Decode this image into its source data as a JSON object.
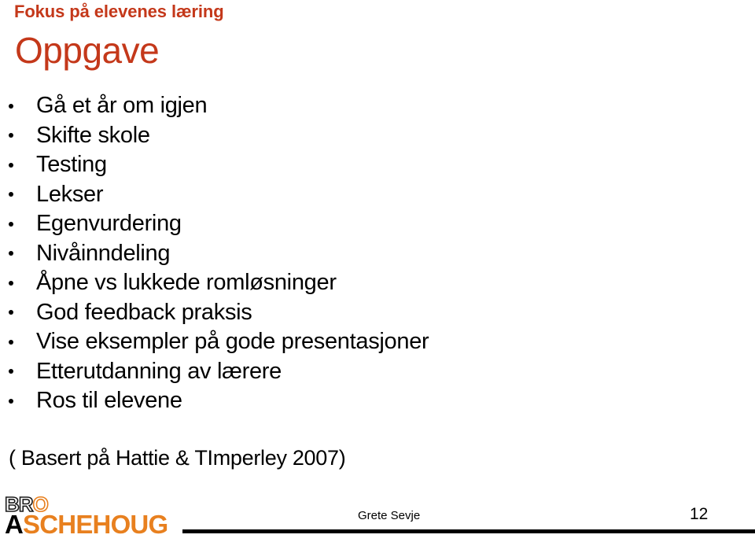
{
  "slide": {
    "kicker": "Fokus på elevenes læring",
    "title": "Oppgave",
    "accent_color": "#c4381a",
    "text_color": "#000000",
    "background_color": "#ffffff"
  },
  "bullets": [
    {
      "label": "Gå et år om igjen"
    },
    {
      "label": "Skifte skole"
    },
    {
      "label": "Testing"
    },
    {
      "label": "Lekser"
    },
    {
      "label": "Egenvurdering"
    },
    {
      "label": "Nivåinndeling"
    },
    {
      "label": "Åpne vs lukkede romløsninger"
    },
    {
      "label": "God feedback praksis"
    },
    {
      "label": "Vise eksempler på gode presentasjoner"
    },
    {
      "label": "Etterutdanning av lærere"
    },
    {
      "label": "Ros til elevene"
    }
  ],
  "source_note": "( Basert på Hattie & TImperley 2007)",
  "footer": {
    "logo": {
      "top_prefix": "BR",
      "top_accent": "O",
      "bottom_accent_first": "A",
      "bottom_rest": "SCHEHOUG",
      "brand_orange": "#e8801f",
      "brand_black": "#000000"
    },
    "author": "Grete Sevje",
    "page_number": "12"
  }
}
